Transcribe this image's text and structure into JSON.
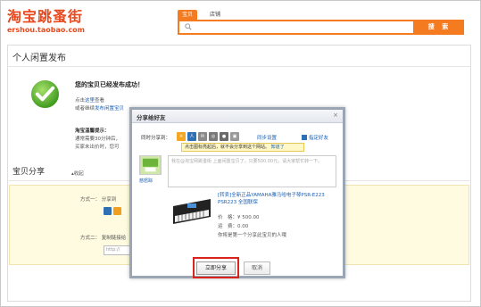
{
  "header": {
    "logo_text": "淘宝跳蚤街",
    "logo_url": "ershou.taobao.com",
    "search_tabs": [
      "宝贝",
      "店铺"
    ],
    "search_button": "搜 索"
  },
  "page": {
    "title": "个人闲置发布",
    "success_title": "您的宝贝已经发布成功！",
    "line1_prefix": "点击",
    "line1_link": "这里",
    "line1_suffix": "查看",
    "line2_prefix": "或者继续",
    "line2_link": "发布闲置宝贝",
    "reminder_title": "淘宝温馨提示：",
    "reminder_line1": "通常需要30分钟后，",
    "reminder_line2": "买家未出价时，您可",
    "share_section_title": "宝贝分享",
    "collapse_label": "收起",
    "method1_label": "方式一：",
    "method1_text": "分享到",
    "method2_label": "方式二：",
    "method2_text": "复制链接给",
    "url_placeholder": "http://"
  },
  "modal": {
    "title": "分享给好友",
    "close": "×",
    "sync_label": "同时分享到：",
    "sync_settings": "同步设置",
    "friend_link": "指定好友",
    "tip_text": "点击图标亮起后，就不会分享到这个网站。",
    "tip_link": "知道了",
    "avatar_name": "慈怒踪",
    "message_placeholder": "我在@淘宝网跳蚤街 上面闲置宝贝了，只要500.00元，请大家帮忙转一下。",
    "product_title": "[转卖]全新正品YAMAHA雅马哈电子琴PSR-E223 PSR223 全国联保",
    "price_label": "价　格：",
    "price_value": "¥ 500.00",
    "shipping_label": "运　费：",
    "shipping_value": "0.00",
    "first_share_note": "你将是第一个分享此宝贝的人哦",
    "share_button": "立即分享",
    "cancel_button": "取消"
  },
  "colors": {
    "brand": "#e8491f",
    "search_orange": "#f57b20",
    "link_blue": "#1a5fb4",
    "highlight_red": "#d9231c",
    "share_bg": "#fffbe0"
  }
}
